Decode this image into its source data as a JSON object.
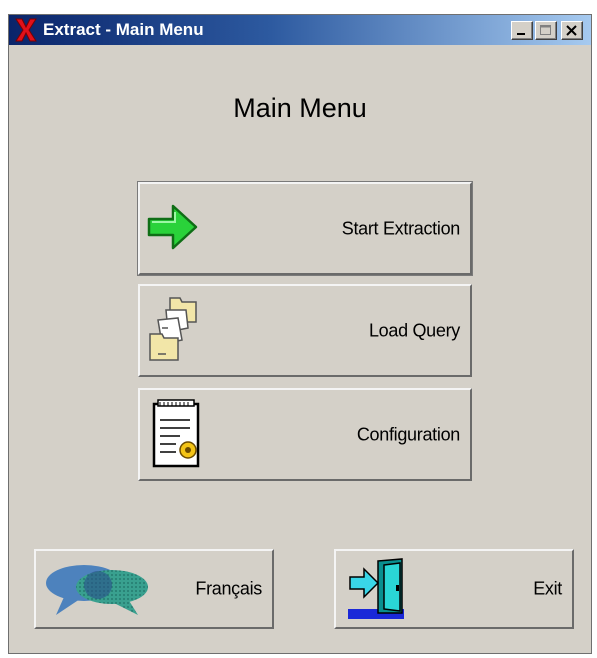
{
  "window": {
    "title": "Extract - Main Menu"
  },
  "heading": "Main Menu",
  "menu": {
    "start_label": "Start Extraction",
    "load_label": "Load Query",
    "config_label": "Configuration"
  },
  "footer": {
    "language_label": "Français",
    "exit_label": "Exit"
  },
  "colors": {
    "titlebar_start": "#0a246a",
    "titlebar_end": "#a6caf0",
    "face": "#d4d0c8",
    "arrow": "#22c42a"
  },
  "icons": [
    "app-x-icon",
    "minimize-icon",
    "maximize-icon",
    "close-icon",
    "green-arrow-icon",
    "folders-icon",
    "document-gear-icon",
    "speech-bubbles-icon",
    "exit-door-icon"
  ]
}
